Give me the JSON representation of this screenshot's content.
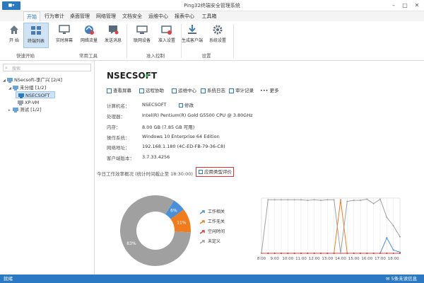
{
  "colors": {
    "accent": "#2b79c2",
    "selected_bg": "#cde3f7",
    "legend_blue": "#4a90d9",
    "legend_orange": "#f07c1e",
    "legend_red": "#e03c3c",
    "legend_gray": "#a0a0a0",
    "online": "#39b54a",
    "highlight_border": "#e03030"
  },
  "window": {
    "app_button": "■▾",
    "title": "Ping32终端安全管理系统",
    "minimize": "–",
    "maximize": "□",
    "close": "✕"
  },
  "menu": {
    "tabs": [
      {
        "label": "开始",
        "active": true
      },
      {
        "label": "行为审计"
      },
      {
        "label": "桌面管理"
      },
      {
        "label": "网络管理"
      },
      {
        "label": "文档安全"
      },
      {
        "label": "运维中心"
      },
      {
        "label": "报表中心"
      },
      {
        "label": "工具箱"
      }
    ]
  },
  "ribbon": {
    "buttons": [
      {
        "label": "开 始",
        "icon": "home-icon"
      },
      {
        "label": "终端列表",
        "icon": "terminal-list-icon",
        "selected": true
      },
      {
        "label": "实时屏幕",
        "icon": "monitor-icon"
      },
      {
        "label": "网络流量",
        "icon": "network-traffic-icon"
      },
      {
        "label": "发送消息",
        "icon": "message-icon"
      },
      {
        "label": "联网设备",
        "icon": "network-device-icon"
      },
      {
        "label": "准入设置",
        "icon": "access-settings-icon"
      },
      {
        "label": "生成客户端",
        "icon": "download-icon"
      },
      {
        "label": "系统设置",
        "icon": "gear-icon"
      }
    ],
    "groups": [
      "快速开始",
      "常用工具",
      "准入控制",
      "设置"
    ]
  },
  "tree": {
    "search_placeholder": "搜索",
    "nodes": [
      {
        "label": "NSecsoft-李广兴  [2/4]",
        "caret": "◢"
      },
      {
        "label": "未分组  [1/2]",
        "caret": "◢"
      },
      {
        "label": "NSECSOFT",
        "selected": true
      },
      {
        "label": "XP-VM"
      },
      {
        "label": "测试  [1/2]",
        "caret": "▸"
      }
    ]
  },
  "main": {
    "host": "NSECSOFT",
    "actions": [
      "查看屏幕",
      "远程协助",
      "运维中心",
      "系统日志",
      "审计记录",
      "更多"
    ],
    "more_prefix": "•••",
    "info": [
      {
        "key": "计算机名：",
        "value": "NSECSOFT",
        "edit": "修改"
      },
      {
        "key": "处理器：",
        "value": "Intel(R) Pentium(R) Gold G5500 CPU @ 3.80GHz"
      },
      {
        "key": "内存：",
        "value": "8.00 GB (7.85 GB 可用)"
      },
      {
        "key": "操作系统：",
        "value": "Windows 10 Enterprise 64 Edition"
      },
      {
        "key": "网络地址：",
        "value": "192.168.1.180   (4C-ED-FB-79-36-C8)"
      },
      {
        "key": "客户端版本：",
        "value": "3.7.33.4256"
      }
    ],
    "today_label": "今日工作效率概况  (统计时间截止至 18:30:00)",
    "eval_button": "应用类型评价"
  },
  "chart_data": [
    {
      "type": "pie",
      "labels": [
        "工作相关",
        "工作无关",
        "空闲时间",
        "未定义"
      ],
      "values": [
        6,
        11,
        0,
        83
      ],
      "data_labels": [
        "6%",
        "11%",
        "",
        "83%"
      ],
      "donut": true,
      "legend": "right"
    },
    {
      "type": "line",
      "x": [
        "8:00",
        "8:30",
        "9:00",
        "9:30",
        "10:00",
        "10:30",
        "11:00",
        "11:30",
        "12:00",
        "12:30",
        "13:00",
        "13:30",
        "14:00",
        "14:30",
        "15:00",
        "15:30",
        "16:00",
        "16:30",
        "17:00",
        "17:30",
        "18:00",
        "18:30"
      ],
      "xticks": [
        "8:00",
        "9:00",
        "10:00",
        "11:00",
        "12:00",
        "13:00",
        "14:00",
        "15:00",
        "16:00",
        "17:00",
        "18:00"
      ],
      "ylim": [
        0,
        100
      ],
      "grid": true,
      "series": [
        {
          "name": "工作相关",
          "color": "#4a90d9",
          "values": [
            0,
            0,
            0,
            0,
            0,
            0,
            0,
            0,
            0,
            0,
            0,
            0,
            0,
            0,
            0,
            0,
            0,
            0,
            0,
            28,
            6,
            2
          ]
        },
        {
          "name": "工作无关",
          "color": "#f07c1e",
          "values": [
            0,
            0,
            0,
            0,
            0,
            0,
            0,
            0,
            0,
            0,
            0,
            0,
            97,
            0,
            0,
            0,
            0,
            0,
            0,
            0,
            0,
            0
          ]
        },
        {
          "name": "空闲时间",
          "color": "#e03c3c",
          "values": [
            0,
            0,
            0,
            0,
            0,
            0,
            0,
            0,
            0,
            0,
            0,
            0,
            0,
            0,
            0,
            0,
            0,
            0,
            0,
            0,
            0,
            0
          ]
        },
        {
          "name": "未定义",
          "color": "#a0a0a0",
          "values": [
            0,
            97,
            97,
            97,
            97,
            97,
            97,
            96,
            97,
            96,
            97,
            97,
            0,
            94,
            96,
            96,
            98,
            90,
            98,
            65,
            50,
            30
          ]
        }
      ]
    }
  ],
  "status": {
    "left": "就绪",
    "right": "5条未读信息"
  }
}
